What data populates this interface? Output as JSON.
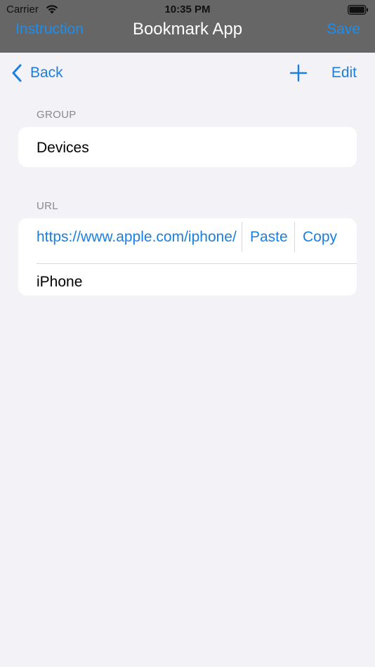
{
  "status_bar": {
    "carrier": "Carrier",
    "time": "10:35 PM"
  },
  "nav": {
    "left": "Instruction",
    "title": "Bookmark App",
    "right": "Save"
  },
  "toolbar": {
    "back": "Back",
    "edit": "Edit"
  },
  "group": {
    "header": "GROUP",
    "value": "Devices"
  },
  "url": {
    "header": "URL",
    "value": "https://www.apple.com/iphone/",
    "paste": "Paste",
    "copy": "Copy",
    "name": "iPhone"
  },
  "colors": {
    "accent": "#1a7fe0",
    "nav_bar": "#666666",
    "background": "#f2f2f7"
  },
  "icons": [
    "wifi-icon",
    "battery-icon",
    "chevron-left-icon",
    "plus-icon"
  ]
}
